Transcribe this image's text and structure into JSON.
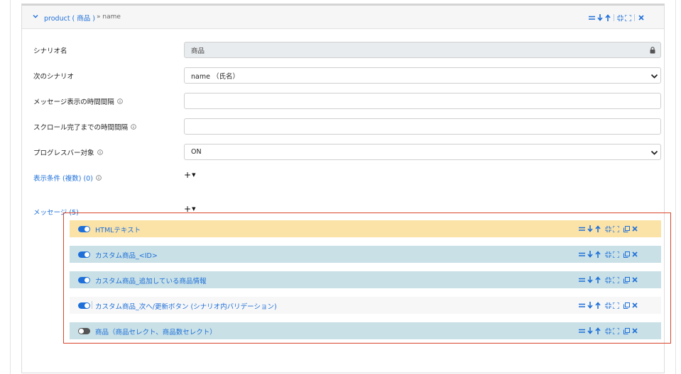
{
  "header": {
    "title": "product ( 商品 )",
    "subtitle": "» name"
  },
  "form": {
    "scenario_name": {
      "label": "シナリオ名",
      "value": "商品"
    },
    "next_scenario": {
      "label": "次のシナリオ",
      "value": "name （氏名）"
    },
    "message_interval": {
      "label": "メッセージ表示の時間間隔",
      "value": ""
    },
    "scroll_interval": {
      "label": "スクロール完了までの時間間隔",
      "value": ""
    },
    "progress_target": {
      "label": "プログレスバー対象",
      "value": "ON"
    },
    "display_conditions": {
      "label": "表示条件 (複数) (0)"
    },
    "messages": {
      "label": "メッセージ (5)"
    }
  },
  "messages": [
    {
      "label": "HTMLテキスト",
      "enabled": true,
      "color": "#fbe3a8"
    },
    {
      "label": "カスタム商品_<ID>",
      "enabled": true,
      "color": "#c8e0e6"
    },
    {
      "label": "カスタム商品_追加している商品情報",
      "enabled": true,
      "color": "#c8e0e6"
    },
    {
      "label": "カスタム商品_次へ/更新ボタン (シナリオ内バリデーション)",
      "enabled": true,
      "color": "#f7f7f7"
    },
    {
      "label": "商品（商品セレクト、商品数セレクト）",
      "enabled": false,
      "color": "#c8e0e6"
    }
  ],
  "adder_symbol": "+",
  "colors": {
    "accent": "#1e6fd9",
    "highlight": "#d9442a"
  }
}
